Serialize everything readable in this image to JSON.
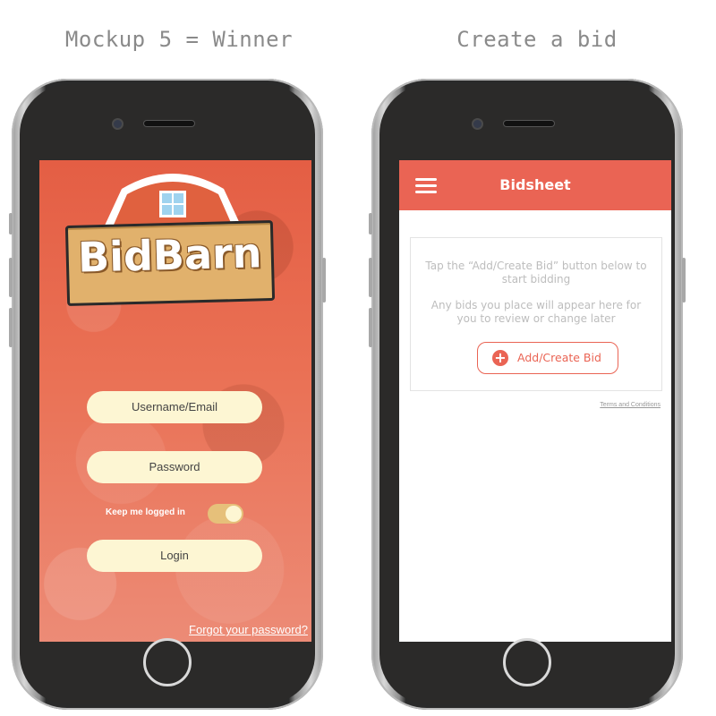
{
  "captions": {
    "left": "Mockup 5 = Winner",
    "right": "Create a bid"
  },
  "login_screen": {
    "logo_text": "BidBarn",
    "username_placeholder": "Username/Email",
    "password_placeholder": "Password",
    "keep_logged_in_label": "Keep me logged in",
    "keep_logged_in_on": true,
    "login_label": "Login",
    "forgot_label": "Forgot your password?",
    "colors": {
      "background": "#e45e44",
      "pill": "#fdf6d3",
      "toggle": "#e6c07a",
      "logo_board": "#e1b16c"
    }
  },
  "bidsheet_screen": {
    "menu_icon": "hamburger-icon",
    "title": "Bidsheet",
    "empty_text_1": "Tap the “Add/Create Bid” button below to start bidding",
    "empty_text_2": "Any bids you place will appear here for you to review or change later",
    "add_button_icon": "plus-circle-icon",
    "add_button_label": "Add/Create Bid",
    "terms_label": "Terms and Conditions",
    "colors": {
      "accent": "#ea6454"
    }
  }
}
